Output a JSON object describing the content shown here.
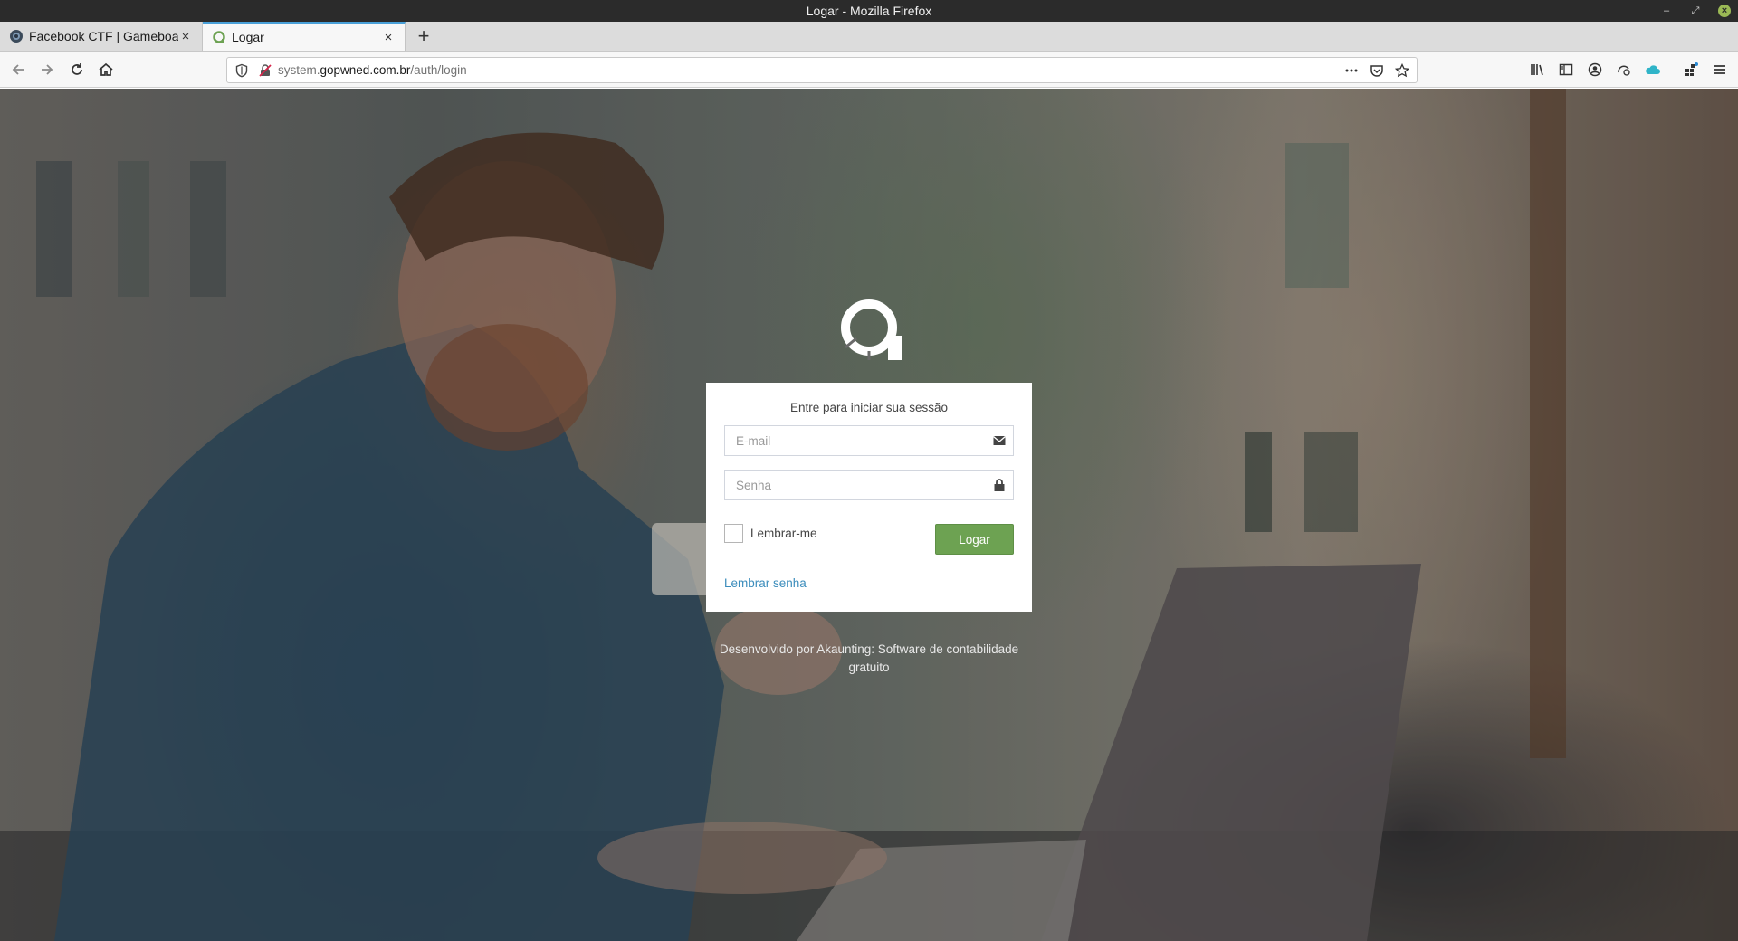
{
  "window": {
    "title": "Logar - Mozilla Firefox"
  },
  "tabs": [
    {
      "label": "Facebook CTF | Gameboard",
      "icon": "facebook-ctf-favicon",
      "active": false
    },
    {
      "label": "Logar",
      "icon": "akaunting-favicon",
      "active": true
    }
  ],
  "navbar": {
    "url_prefix": "system.",
    "url_domain": "gopwned.com.br",
    "url_path": "/auth/login",
    "icons": [
      "back-icon",
      "forward-icon",
      "reload-icon",
      "home-icon",
      "shield-icon",
      "insecure-lock-icon",
      "more-icon",
      "pocket-icon",
      "bookmark-star-icon",
      "library-icon",
      "sidebar-icon",
      "account-icon",
      "sync-icon",
      "cloud-icon",
      "extensions-icon",
      "menu-icon"
    ]
  },
  "login": {
    "message": "Entre para iniciar sua sessão",
    "email_placeholder": "E-mail",
    "password_placeholder": "Senha",
    "remember_label": "Lembrar-me",
    "submit_label": "Logar",
    "forgot_label": "Lembrar senha"
  },
  "footer": {
    "text": "Desenvolvido por Akaunting: Software de contabilidade gratuito"
  },
  "colors": {
    "primary_button": "#6da252",
    "link": "#3c8dbc",
    "tab_accent": "#49a0d8"
  }
}
